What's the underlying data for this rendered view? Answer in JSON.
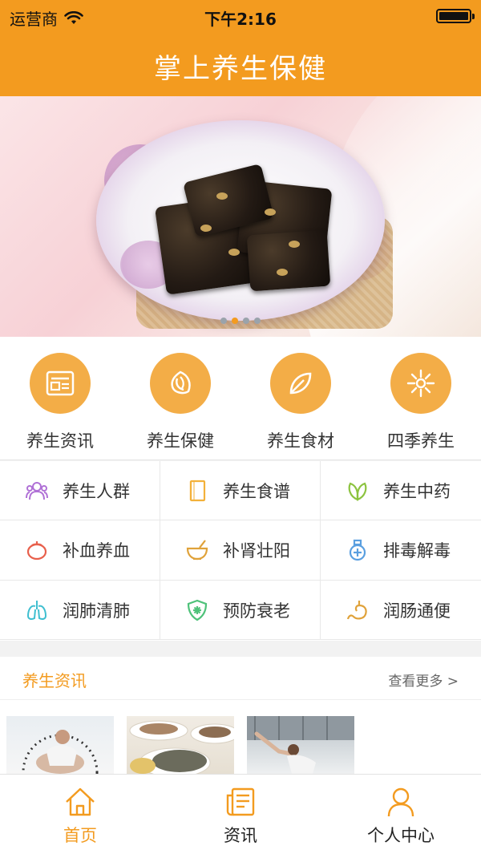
{
  "status_bar": {
    "carrier": "运营商",
    "time": "下午2:16"
  },
  "nav": {
    "title": "掌上养生保健"
  },
  "banner": {
    "slides": 4,
    "active_index": 1
  },
  "categories": [
    {
      "label": "养生资讯",
      "icon": "news-icon"
    },
    {
      "label": "养生保健",
      "icon": "leaf-circle-icon"
    },
    {
      "label": "养生食材",
      "icon": "leaf-icon"
    },
    {
      "label": "四季养生",
      "icon": "snowflake-icon"
    }
  ],
  "grid": [
    {
      "label": "养生人群",
      "icon": "people-icon",
      "color": "#b071d6"
    },
    {
      "label": "养生食谱",
      "icon": "recipe-icon",
      "color": "#f3b13a"
    },
    {
      "label": "养生中药",
      "icon": "herb-icon",
      "color": "#8cc33f"
    },
    {
      "label": "补血养血",
      "icon": "tomato-icon",
      "color": "#e8604c"
    },
    {
      "label": "补肾壮阳",
      "icon": "mortar-icon",
      "color": "#e0a23a"
    },
    {
      "label": "排毒解毒",
      "icon": "bottle-icon",
      "color": "#5a9fe0"
    },
    {
      "label": "润肺清肺",
      "icon": "lungs-icon",
      "color": "#3fbfd0"
    },
    {
      "label": "预防衰老",
      "icon": "shield-icon",
      "color": "#4fc27a"
    },
    {
      "label": "润肠通便",
      "icon": "stomach-icon",
      "color": "#e0a23a"
    }
  ],
  "section": {
    "title": "养生资讯",
    "more": "查看更多 >"
  },
  "tabs": [
    {
      "label": "首页",
      "icon": "home-icon",
      "active": true
    },
    {
      "label": "资讯",
      "icon": "article-icon",
      "active": false
    },
    {
      "label": "个人中心",
      "icon": "user-icon",
      "active": false
    }
  ],
  "colors": {
    "primary": "#f39b1f",
    "icon_circle": "#f3ad47"
  }
}
